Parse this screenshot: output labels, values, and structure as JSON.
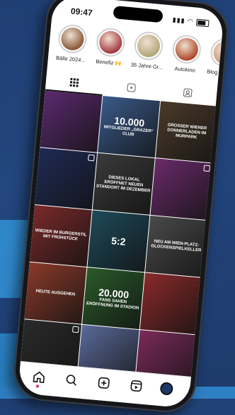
{
  "status": {
    "time": "09:47"
  },
  "stories": [
    {
      "label": "Bälle 2024...",
      "color": "#8a5a3a"
    },
    {
      "label": "Benefiz 🙌",
      "color": "#a43a40"
    },
    {
      "label": "35 Jahre Gr...",
      "color": "#b3a77a"
    },
    {
      "label": "Autokino",
      "color": "#b04a2a"
    },
    {
      "label": "Blog achtse...",
      "color": "#c89a7a"
    }
  ],
  "tabs": [
    {
      "name": "grid-icon",
      "glyph": "▦"
    },
    {
      "name": "reels-icon",
      "glyph": "▶"
    },
    {
      "name": "tagged-icon",
      "glyph": "👤"
    }
  ],
  "posts": [
    {
      "big": "",
      "text": "",
      "color": "#5b2a6e"
    },
    {
      "big": "10.000",
      "text": "Mitglieder „Grazer“ Club",
      "color": "#3a5a8a"
    },
    {
      "big": "",
      "text": "Grosser Wiener Donnerladen im Murpark",
      "color": "#4a3a2a"
    },
    {
      "big": "",
      "text": "",
      "color": "#1f2a55"
    },
    {
      "big": "",
      "text": "Dieses Lokal eröffnet neuen Standort im Dezember",
      "color": "#3a3a3a"
    },
    {
      "big": "",
      "text": "",
      "color": "#6a2a6a"
    },
    {
      "big": "",
      "text": "Wieder im Burgerstil mit Frühstück",
      "color": "#7a2a2a"
    },
    {
      "big": "5:2",
      "text": "",
      "color": "#1e4a5a"
    },
    {
      "big": "",
      "text": "Neu am Wien-Platz: Glockenspielkeller",
      "color": "#4a4a4a"
    },
    {
      "big": "",
      "text": "Heute Ausgehen",
      "color": "#8a3a2a"
    },
    {
      "big": "20.000",
      "text": "Fans sahen Eröffnung im Stadion",
      "color": "#2a5a2a"
    },
    {
      "big": "",
      "text": "",
      "color": "#8a2a2a"
    },
    {
      "big": "",
      "text": "",
      "color": "#2a2a2a"
    },
    {
      "big": "",
      "text": "",
      "color": "#5a6a9a"
    },
    {
      "big": "",
      "text": "",
      "color": "#7a2a5a"
    }
  ],
  "nav": [
    {
      "name": "home-icon",
      "glyph": "⌂"
    },
    {
      "name": "search-icon",
      "glyph": "⌕"
    },
    {
      "name": "create-icon",
      "glyph": "⊞"
    },
    {
      "name": "reels-nav-icon",
      "glyph": "▶"
    },
    {
      "name": "profile-avatar",
      "glyph": ""
    }
  ]
}
